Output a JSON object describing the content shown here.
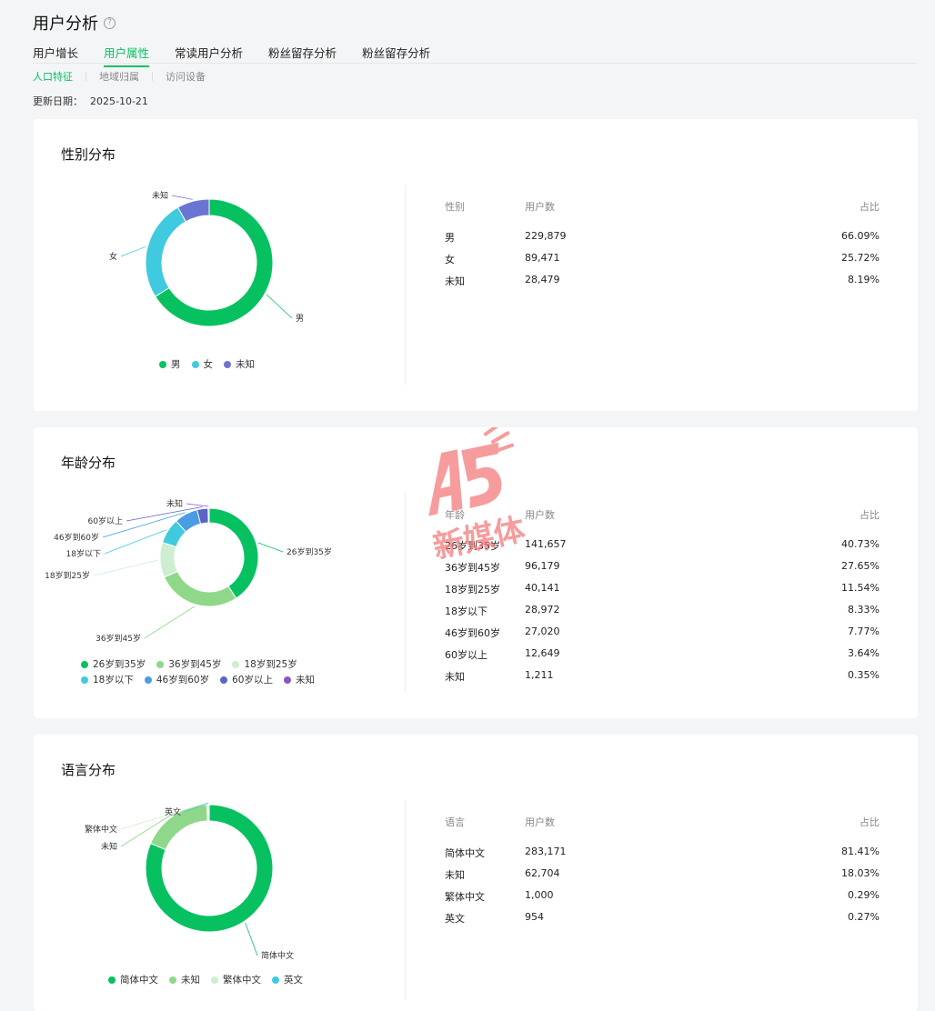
{
  "header": {
    "title": "用户分析",
    "help": "?"
  },
  "tabs": [
    "用户增长",
    "用户属性",
    "常读用户分析",
    "粉丝留存分析",
    "粉丝留存分析"
  ],
  "active_tab": 1,
  "subtabs": [
    "人口特征",
    "地域归属",
    "访问设备"
  ],
  "active_subtab": 0,
  "update": {
    "label": "更新日期：",
    "value": "2025-10-21"
  },
  "watermark": {
    "brand": "A5",
    "text": "新媒体",
    "color": "#f47b7b"
  },
  "gender": {
    "title": "性别分布",
    "headers": [
      "性别",
      "用户数",
      "占比"
    ],
    "rows": [
      {
        "name": "男",
        "count": "229,879",
        "pct": "66.09%",
        "value": 66.09,
        "color": "#07c160"
      },
      {
        "name": "女",
        "count": "89,471",
        "pct": "25.72%",
        "value": 25.72,
        "color": "#3fcae0"
      },
      {
        "name": "未知",
        "count": "28,479",
        "pct": "8.19%",
        "value": 8.19,
        "color": "#6a75d1"
      }
    ]
  },
  "age": {
    "title": "年龄分布",
    "headers": [
      "年龄",
      "用户数",
      "占比"
    ],
    "rows": [
      {
        "name": "26岁到35岁",
        "count": "141,657",
        "pct": "40.73%",
        "value": 40.73,
        "color": "#07c160"
      },
      {
        "name": "36岁到45岁",
        "count": "96,179",
        "pct": "27.65%",
        "value": 27.65,
        "color": "#8fd88a"
      },
      {
        "name": "18岁到25岁",
        "count": "40,141",
        "pct": "11.54%",
        "value": 11.54,
        "color": "#cdeed0"
      },
      {
        "name": "18岁以下",
        "count": "28,972",
        "pct": "8.33%",
        "value": 8.33,
        "color": "#3fcae0"
      },
      {
        "name": "46岁到60岁",
        "count": "27,020",
        "pct": "7.77%",
        "value": 7.77,
        "color": "#4a9de4"
      },
      {
        "name": "60岁以上",
        "count": "12,649",
        "pct": "3.64%",
        "value": 3.64,
        "color": "#5b64c6"
      },
      {
        "name": "未知",
        "count": "1,211",
        "pct": "0.35%",
        "value": 0.35,
        "color": "#8b55c8"
      }
    ]
  },
  "language": {
    "title": "语言分布",
    "headers": [
      "语言",
      "用户数",
      "占比"
    ],
    "rows": [
      {
        "name": "简体中文",
        "count": "283,171",
        "pct": "81.41%",
        "value": 81.41,
        "color": "#07c160"
      },
      {
        "name": "未知",
        "count": "62,704",
        "pct": "18.03%",
        "value": 18.03,
        "color": "#8fd88a"
      },
      {
        "name": "繁体中文",
        "count": "1,000",
        "pct": "0.29%",
        "value": 0.29,
        "color": "#cdeed0"
      },
      {
        "name": "英文",
        "count": "954",
        "pct": "0.27%",
        "value": 0.27,
        "color": "#3fcae0"
      }
    ]
  }
}
